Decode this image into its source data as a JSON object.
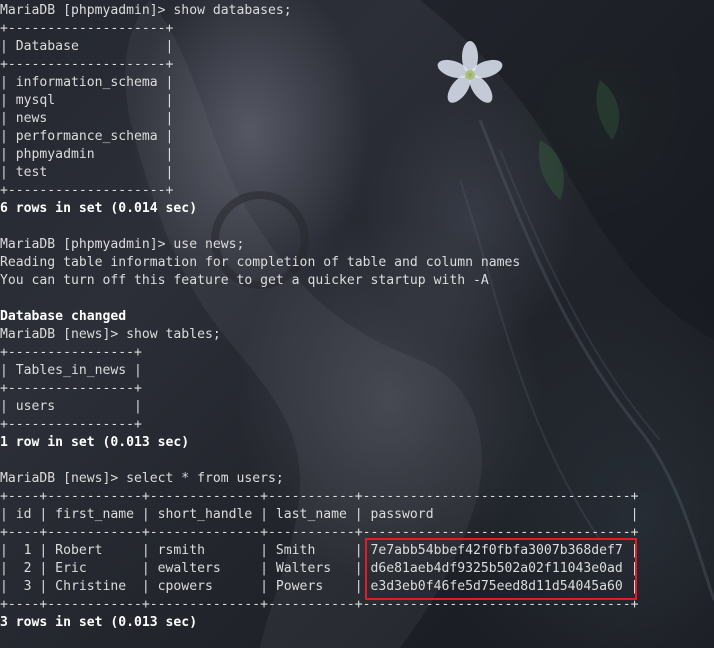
{
  "terminal": {
    "lines": [
      {
        "text": "MariaDB [phpmyadmin]> show databases;",
        "bold": false
      },
      {
        "text": "+--------------------+",
        "bold": false
      },
      {
        "text": "| Database           |",
        "bold": false
      },
      {
        "text": "+--------------------+",
        "bold": false
      },
      {
        "text": "| information_schema |",
        "bold": false
      },
      {
        "text": "| mysql              |",
        "bold": false
      },
      {
        "text": "| news               |",
        "bold": false
      },
      {
        "text": "| performance_schema |",
        "bold": false
      },
      {
        "text": "| phpmyadmin         |",
        "bold": false
      },
      {
        "text": "| test               |",
        "bold": false
      },
      {
        "text": "+--------------------+",
        "bold": false
      },
      {
        "text": "6 rows in set (0.014 sec)",
        "bold": true
      },
      {
        "text": "",
        "bold": false
      },
      {
        "text": "MariaDB [phpmyadmin]> use news;",
        "bold": false
      },
      {
        "text": "Reading table information for completion of table and column names",
        "bold": false
      },
      {
        "text": "You can turn off this feature to get a quicker startup with -A",
        "bold": false
      },
      {
        "text": "",
        "bold": false
      },
      {
        "text": "Database changed",
        "bold": true
      },
      {
        "text": "MariaDB [news]> show tables;",
        "bold": false
      },
      {
        "text": "+----------------+",
        "bold": false
      },
      {
        "text": "| Tables_in_news |",
        "bold": false
      },
      {
        "text": "+----------------+",
        "bold": false
      },
      {
        "text": "| users          |",
        "bold": false
      },
      {
        "text": "+----------------+",
        "bold": false
      },
      {
        "text": "1 row in set (0.013 sec)",
        "bold": true
      },
      {
        "text": "",
        "bold": false
      },
      {
        "text": "MariaDB [news]> select * from users;",
        "bold": false
      },
      {
        "text": "+----+------------+--------------+-----------+----------------------------------+",
        "bold": false
      },
      {
        "text": "| id | first_name | short_handle | last_name | password                         |",
        "bold": false
      },
      {
        "text": "+----+------------+--------------+-----------+----------------------------------+",
        "bold": false
      },
      {
        "text": "|  1 | Robert     | rsmith       | Smith     | 7e7abb54bbef42f0fbfa3007b368def7 |",
        "bold": false
      },
      {
        "text": "|  2 | Eric       | ewalters     | Walters   | d6e81aeb4df9325b502a02f11043e0ad |",
        "bold": false
      },
      {
        "text": "|  3 | Christine  | cpowers      | Powers    | e3d3eb0f46fe5d75eed8d11d54045a60 |",
        "bold": false
      },
      {
        "text": "+----+------------+--------------+-----------+----------------------------------+",
        "bold": false
      },
      {
        "text": "3 rows in set (0.013 sec)",
        "bold": true
      }
    ]
  },
  "colors": {
    "text": "#dcdcdc",
    "bold_text": "#ffffff",
    "highlight_border": "#e01c24"
  }
}
